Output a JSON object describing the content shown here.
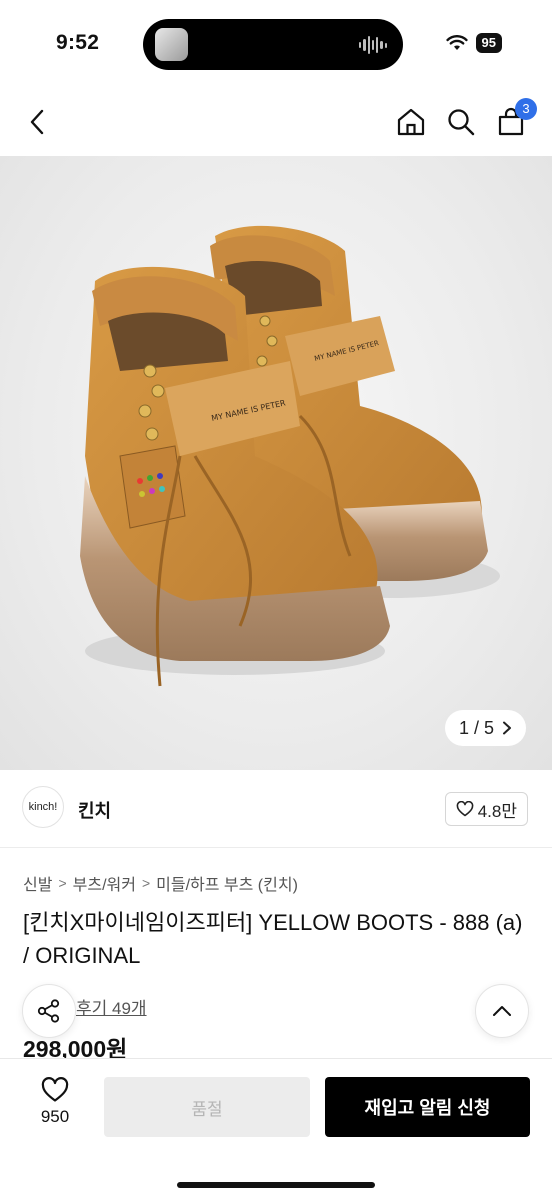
{
  "status": {
    "time": "9:52",
    "battery": "95"
  },
  "header": {
    "cart_count": "3"
  },
  "gallery": {
    "counter": "1 / 5",
    "logo_tongue": "MY NAME IS PETER"
  },
  "brand": {
    "logo_text": "kinch!",
    "name": "킨치",
    "likes": "4.8만"
  },
  "breadcrumb": [
    "신발",
    "부츠/워커",
    "미들/하프 부츠 (킨치)"
  ],
  "product": {
    "title": "[킨치X마이네임이즈피터] YELLOW BOOTS - 888 (a) / ORIGINAL",
    "reviews": "후기 49개",
    "price": "298,000원"
  },
  "bottom": {
    "wish_count": "950",
    "soldout_label": "품절",
    "restock_label": "재입고 알림 신청"
  },
  "colors": {
    "accent": "#2f6fe8",
    "boot": "#c98a3a",
    "sole": "#b08a66"
  }
}
